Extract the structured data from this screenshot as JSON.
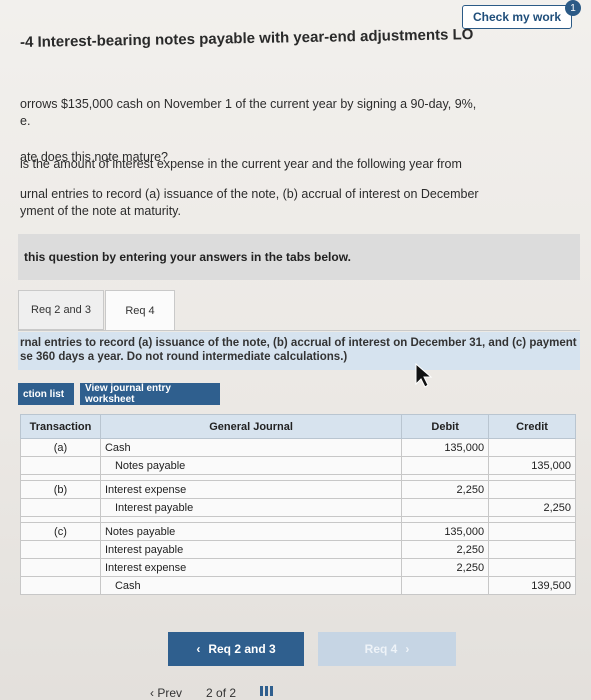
{
  "header": {
    "check_label": "Check my work",
    "badge_count": "1",
    "title": "-4 Interest-bearing notes payable with year-end adjustments LO"
  },
  "problem": {
    "line1": "orrows $135,000 cash on November 1 of the current year by signing a 90-day, 9%,",
    "line2": "e.",
    "q1": "ate does this note mature?",
    "q2": "is the amount of interest expense in the current year and the following year from",
    "q3": "urnal entries to record (a) issuance of the note, (b) accrual of interest on December",
    "q4": "yment of the note at maturity."
  },
  "instructions": "this question by entering your answers in the tabs below.",
  "tabs": [
    {
      "label": "Req 2 and 3",
      "active": false
    },
    {
      "label": "Req 4",
      "active": true
    }
  ],
  "req_instructions": {
    "line1": "rnal entries to record (a) issuance of the note, (b) accrual of interest on December 31, and (c) payment",
    "line2": "se 360 days a year. Do not round intermediate calculations.)"
  },
  "buttons": {
    "transaction_list": "ction list",
    "view_worksheet": "View journal entry worksheet"
  },
  "journal": {
    "headers": {
      "transaction": "Transaction",
      "general_journal": "General Journal",
      "debit": "Debit",
      "credit": "Credit"
    },
    "rows": [
      {
        "txn": "(a)",
        "account": "Cash",
        "indent": false,
        "debit": "135,000",
        "credit": ""
      },
      {
        "txn": "",
        "account": "Notes payable",
        "indent": true,
        "debit": "",
        "credit": "135,000"
      },
      {
        "txn": "(b)",
        "account": "Interest expense",
        "indent": false,
        "debit": "2,250",
        "credit": ""
      },
      {
        "txn": "",
        "account": "Interest payable",
        "indent": true,
        "debit": "",
        "credit": "2,250"
      },
      {
        "txn": "(c)",
        "account": "Notes payable",
        "indent": false,
        "debit": "135,000",
        "credit": ""
      },
      {
        "txn": "",
        "account": "Interest payable",
        "indent": false,
        "debit": "2,250",
        "credit": ""
      },
      {
        "txn": "",
        "account": "Interest expense",
        "indent": false,
        "debit": "2,250",
        "credit": ""
      },
      {
        "txn": "",
        "account": "Cash",
        "indent": true,
        "debit": "",
        "credit": "139,500"
      }
    ]
  },
  "nav": {
    "prev_req": "Req 2 and 3",
    "next_req": "Req 4",
    "prev_page": "Prev",
    "page_indicator": "2 of 2"
  },
  "colors": {
    "accent": "#2f5f8e",
    "header_bg": "#d7e3ee",
    "instr_bg": "#d6e3ef"
  }
}
